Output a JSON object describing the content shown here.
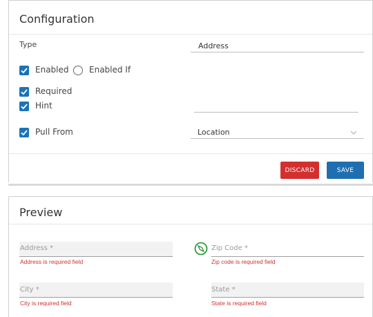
{
  "config": {
    "title": "Configuration",
    "type_label": "Type",
    "type_value": "Address",
    "enabled_label": "Enabled",
    "enabled_if_label": "Enabled If",
    "required_label": "Required",
    "hint_label": "Hint",
    "hint_value": "",
    "pull_from_label": "Pull From",
    "pull_from_value": "Location",
    "discard_label": "DISCARD",
    "save_label": "SAVE",
    "enabled_checked": true,
    "enabled_if_selected": false,
    "required_checked": true,
    "hint_checked": true,
    "pull_from_checked": true
  },
  "preview": {
    "title": "Preview",
    "fields": [
      {
        "label": "Address *",
        "error": "Address is required field"
      },
      {
        "label": "Zip Code *",
        "error": "Zip code is required field"
      },
      {
        "label": "City *",
        "error": "City is required field"
      },
      {
        "label": "State *",
        "error": "State is required field"
      }
    ]
  },
  "colors": {
    "accent": "#1a73b8",
    "discard": "#d32f2f",
    "save": "#1f6fb0",
    "error": "#d32f2f",
    "compass": "#2e9a3e"
  }
}
